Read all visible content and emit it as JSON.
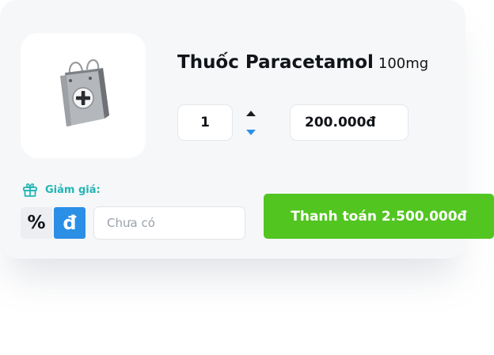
{
  "product": {
    "image_icon": "medicine-bag-icon",
    "name": "Thuốc Paracetamol",
    "dose": "100mg"
  },
  "quantity": {
    "value": "1",
    "increase_icon": "caret-up-icon",
    "decrease_icon": "caret-down-icon"
  },
  "unit_price": "200.000đ",
  "discount": {
    "icon": "gift-icon",
    "label": "Giảm giá:",
    "percent_symbol": "%",
    "currency_symbol": "đ",
    "active_mode": "currency",
    "input_placeholder": "Chưa có"
  },
  "checkout": {
    "label": "Thanh toán 2.500.000đ"
  },
  "colors": {
    "accent_teal": "#23b5b5",
    "accent_blue": "#2b8fe6",
    "pay_green": "#52c521"
  }
}
